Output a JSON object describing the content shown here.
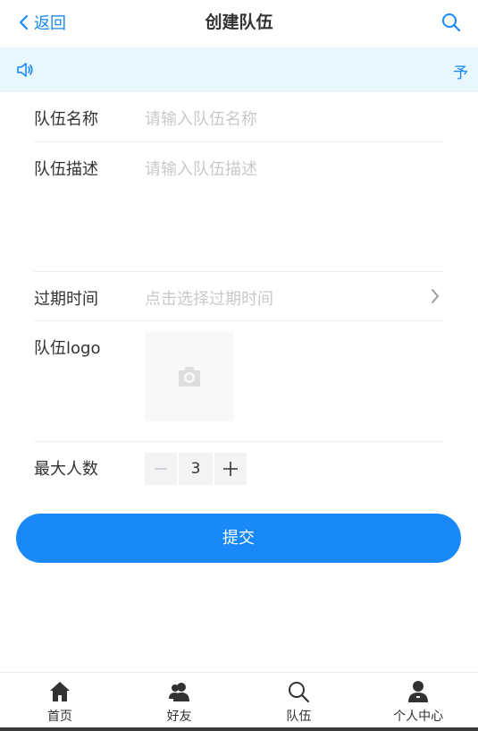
{
  "nav": {
    "back_label": "返回",
    "title": "创建队伍"
  },
  "notice": {
    "text": "予"
  },
  "form": {
    "name_label": "队伍名称",
    "name_placeholder": "请输入队伍名称",
    "desc_label": "队伍描述",
    "desc_placeholder": "请输入队伍描述",
    "expire_label": "过期时间",
    "expire_placeholder": "点击选择过期时间",
    "logo_label": "队伍logo",
    "max_label": "最大人数",
    "max_value": "3"
  },
  "submit_label": "提交",
  "tabbar": {
    "items": [
      {
        "label": "首页",
        "icon": "home-icon"
      },
      {
        "label": "好友",
        "icon": "friends-icon"
      },
      {
        "label": "队伍",
        "icon": "search-icon"
      },
      {
        "label": "个人中心",
        "icon": "user-icon"
      }
    ]
  },
  "colors": {
    "primary": "#1989fa",
    "notice_bg": "#e8f6fd",
    "placeholder": "#c8c9cc"
  }
}
